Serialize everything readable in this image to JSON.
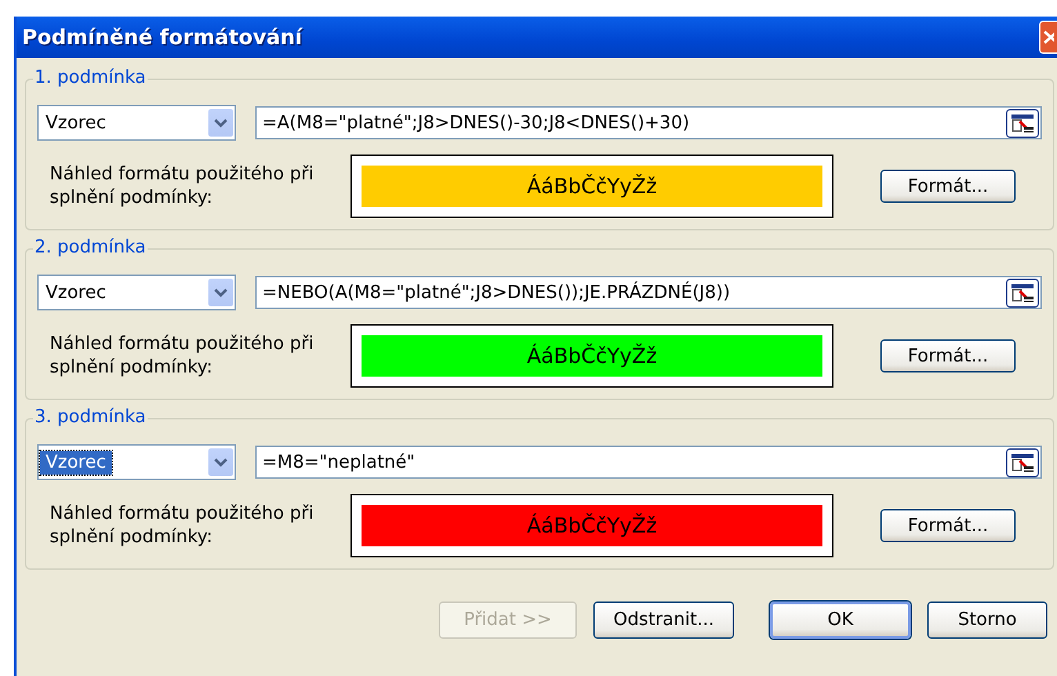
{
  "window": {
    "title": "Podmíněné formátování"
  },
  "conditions": [
    {
      "label": "1. podmínka",
      "type": "Vzorec",
      "type_selected": false,
      "formula": "=A(M8=\"platné\";J8>DNES()-30;J8<DNES()+30)",
      "preview_label": "Náhled formátu použitého při splnění podmínky:",
      "preview_text": "ÁáBbČčYyŽž",
      "color": "#ffcc00",
      "format_button": "Formát..."
    },
    {
      "label": "2. podmínka",
      "type": "Vzorec",
      "type_selected": false,
      "formula": "=NEBO(A(M8=\"platné\";J8>DNES());JE.PRÁZDNÉ(J8))",
      "preview_label": "Náhled formátu použitého při splnění podmínky:",
      "preview_text": "ÁáBbČčYyŽž",
      "color": "#00ff00",
      "format_button": "Formát..."
    },
    {
      "label": "3. podmínka",
      "type": "Vzorec",
      "type_selected": true,
      "formula": "=M8=\"neplatné\"",
      "preview_label": "Náhled formátu použitého při splnění podmínky:",
      "preview_text": "ÁáBbČčYyŽž",
      "color": "#ff0000",
      "format_button": "Formát..."
    }
  ],
  "buttons": [
    {
      "label": "Přidat >>",
      "disabled": true,
      "default": false
    },
    {
      "label": "Odstranit...",
      "disabled": false,
      "default": false
    },
    {
      "label": "OK",
      "disabled": false,
      "default": true
    },
    {
      "label": "Storno",
      "disabled": false,
      "default": false
    }
  ]
}
